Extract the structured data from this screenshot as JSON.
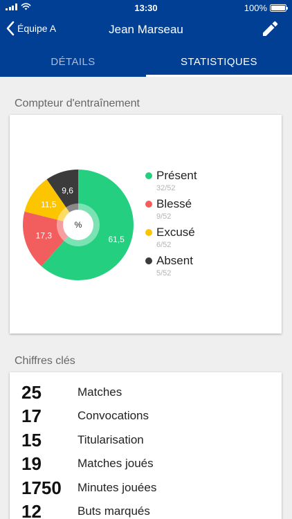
{
  "status_bar": {
    "time": "13:30",
    "battery": "100%"
  },
  "nav": {
    "back_label": "Équipe A",
    "title": "Jean Marseau"
  },
  "tabs": [
    {
      "label": "DÉTAILS",
      "active": false
    },
    {
      "label": "STATISTIQUES",
      "active": true
    }
  ],
  "training": {
    "section_title": "Compteur d'entraînement",
    "center_label": "%"
  },
  "chart_data": {
    "type": "pie",
    "title": "",
    "center_label": "%",
    "series": [
      {
        "name": "Présent",
        "value": 61.5,
        "value_label": "61,5",
        "count": "32/52",
        "color": "#24cf80"
      },
      {
        "name": "Blessé",
        "value": 17.3,
        "value_label": "17,3",
        "count": "9/52",
        "color": "#f25e5e"
      },
      {
        "name": "Excusé",
        "value": 11.5,
        "value_label": "11,5",
        "count": "6/52",
        "color": "#fcc500"
      },
      {
        "name": "Absent",
        "value": 9.6,
        "value_label": "9,6",
        "count": "5/52",
        "color": "#3b3b3b"
      }
    ]
  },
  "key_figures": {
    "section_title": "Chiffres clés",
    "items": [
      {
        "value": "25",
        "label": "Matches"
      },
      {
        "value": "17",
        "label": "Convocations"
      },
      {
        "value": "15",
        "label": "Titularisation"
      },
      {
        "value": "19",
        "label": "Matches joués"
      },
      {
        "value": "1750",
        "label": "Minutes jouées"
      },
      {
        "value": "12",
        "label": "Buts marqués"
      }
    ]
  },
  "colors": {
    "header": "#003f93",
    "background": "#efefef"
  }
}
